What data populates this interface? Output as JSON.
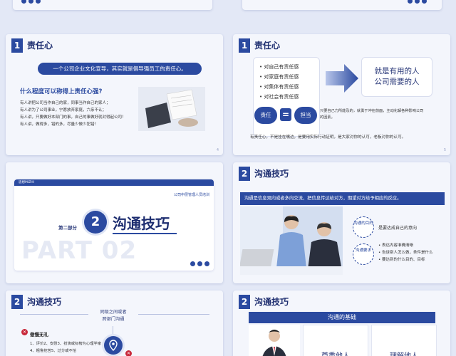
{
  "slide4": {
    "header_num": "1",
    "header_title": "责任心",
    "banner": "一个公司企业文化宣导，其实就是倡导强员工的责任心。",
    "question": "什么程度可以称得上责任心强?",
    "lines": [
      "有人讲把公司当作自己的家，同事当作自己的家人；",
      "有人讲为了公司事业，宁愿放弃家庭，六亲不认；",
      "有人讲，只要做好本部门的事，自己的事做好就对得起公司！",
      "有人讲，做得多，错的多，尽量少做少犯错！"
    ],
    "page": "4"
  },
  "slide5": {
    "header_num": "1",
    "header_title": "责任心",
    "list": [
      "对自己有责任感",
      "对家庭有责任感",
      "对集体有责任感",
      "对社会有责任感"
    ],
    "result": "就是有用的人\n公司需要的人",
    "eq_left": "责任",
    "eq_sign": "=",
    "eq_right": "担当",
    "eq_desc": "只要自己力所能及的，就勇于冲在前面，主动化解各种影响公司的因素。",
    "bottom": "有责任心，不是挂在嘴边，是要用实际行动证明，是大家对你的认可，老板对你的认可。",
    "page": "5"
  },
  "slide6": {
    "tag": "思想MIZHI",
    "company": "公司中层管理人员培训",
    "part_label": "第二部分",
    "num": "2",
    "title": "沟通技巧",
    "watermark": "PART 02"
  },
  "slide7": {
    "header_num": "2",
    "header_title": "沟通技巧",
    "banner": "沟通是信息双向或者多向交流，把信息传达给对方，期望对方给予相应的反应。",
    "circle1": "沟通的目的",
    "circle1_text": "是要达成自己的意向",
    "circle2": "沟通要求",
    "circle2_lines": [
      "表达内容准确清晰",
      "告诉别人怎么做，条件是什么",
      "要达到的什么目的、目标"
    ]
  },
  "slide8": {
    "header_num": "2",
    "header_title": "沟通技巧",
    "top_label": "同级之间或者\n跨部门沟通",
    "item_title": "傲慢无礼",
    "item_text": "1、评价2、安慰3、扮演或标榜为心理学家4、粗鲁挖苦5、过分或不恰"
  },
  "slide9": {
    "header_num": "2",
    "header_title": "沟通技巧",
    "banner": "沟通的基础",
    "card1": "尊重他人",
    "card2": "理解他人"
  },
  "colors": {
    "primary": "#2b4aa0",
    "light": "#f4f6fc",
    "bg": "#e3e8f6",
    "red": "#c8283a"
  }
}
